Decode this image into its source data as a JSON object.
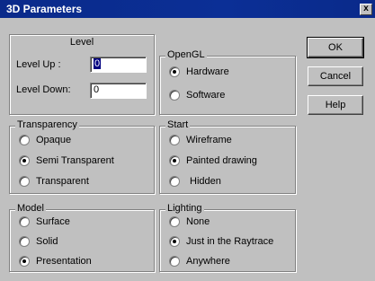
{
  "window": {
    "title": "3D Parameters",
    "close_glyph": "x"
  },
  "level": {
    "heading": "Level",
    "up_label": "Level Up  :",
    "up_value": "0",
    "down_label": "Level Down:",
    "down_value": "0"
  },
  "opengl": {
    "label": "OpenGL",
    "options": [
      "Hardware",
      "Software"
    ],
    "selected": "Hardware"
  },
  "transparency": {
    "label": "Transparency",
    "options": [
      "Opaque",
      "Semi Transparent",
      "Transparent"
    ],
    "selected": "Semi Transparent"
  },
  "start": {
    "label": "Start",
    "options": [
      "Wireframe",
      "Painted drawing",
      "Hidden"
    ],
    "selected": "Painted drawing"
  },
  "model": {
    "label": "Model",
    "options": [
      "Surface",
      "Solid",
      "Presentation"
    ],
    "selected": "Presentation"
  },
  "lighting": {
    "label": "Lighting",
    "options": [
      "None",
      "Just in the Raytrace",
      "Anywhere"
    ],
    "selected": "Just in the Raytrace"
  },
  "buttons": {
    "ok": "OK",
    "cancel": "Cancel",
    "help": "Help"
  },
  "colors": {
    "title_bar": "#0a2a8a",
    "face": "#c0c0c0"
  }
}
